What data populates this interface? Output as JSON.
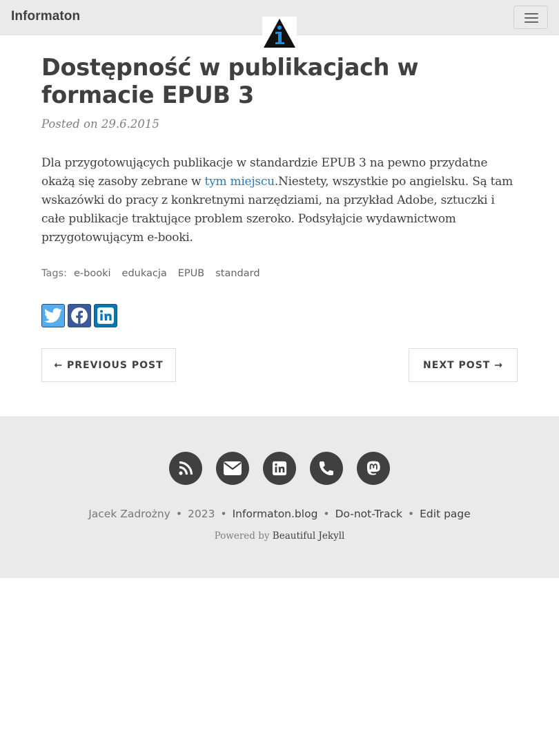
{
  "navbar": {
    "brand": "Informaton"
  },
  "post": {
    "title": "Dostępność w publikacjach w formacie EPUB 3",
    "meta": "Posted on 29.6.2015",
    "body_before_link": "Dla przygotowujących publikacje w standardzie EPUB 3 na pewno przydatne okażą się zasoby zebrane w ",
    "link_text": "tym miejscu",
    "body_after_link": ".Niestety, wszystkie po angielsku. Są tam wskazówki do pracy z konkretnymi narzędziami, na przykład Adobe, sztuczki i całe publikacje traktujące problem szeroko. Podsyłajcie wydawnictwom przygotowującym e-booki."
  },
  "tags": {
    "label": "Tags:",
    "items": [
      "e-booki",
      "edukacja",
      "EPUB",
      "standard"
    ]
  },
  "share": {
    "icons": [
      "twitter-icon",
      "facebook-icon",
      "linkedin-icon"
    ]
  },
  "pager": {
    "previous": "← PREVIOUS POST",
    "next": "NEXT POST →"
  },
  "footer": {
    "social_icons": [
      "rss-icon",
      "envelope-icon",
      "linkedin-icon",
      "phone-icon",
      "mastodon-icon"
    ],
    "author": "Jacek Zadrożny",
    "year": "2023",
    "site": "Informaton.blog",
    "dnt": "Do-not-Track",
    "edit": "Edit page",
    "separator": "•",
    "powered_prefix": "Powered by ",
    "powered_link": "Beautiful Jekyll"
  },
  "colors": {
    "navbar_bg": "#eaeaea",
    "link": "#2a7ab8",
    "footer_icon_bg": "#404040",
    "twitter": "#55acee",
    "facebook": "#3b5998",
    "linkedin": "#0077b5"
  }
}
